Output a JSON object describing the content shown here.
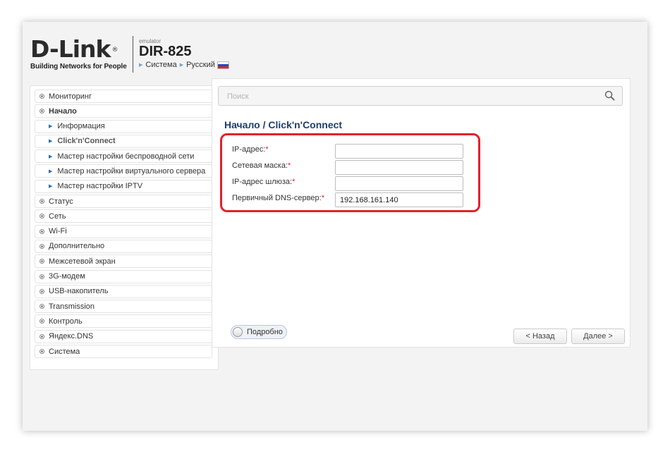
{
  "header": {
    "logo_text": "D-Link",
    "logo_reg": "®",
    "logo_tagline": "Building Networks for People",
    "emulator_label": "emulator",
    "model": "DIR-825",
    "nav_system": "Система",
    "nav_language": "Русский"
  },
  "sidebar": {
    "items": [
      {
        "label": "Мониторинг"
      },
      {
        "label": "Начало"
      },
      {
        "label": "Информация"
      },
      {
        "label": "Click'n'Connect"
      },
      {
        "label": "Мастер настройки беспроводной сети"
      },
      {
        "label": "Мастер настройки виртуального сервера"
      },
      {
        "label": "Мастер настройки IPTV"
      },
      {
        "label": "Статус"
      },
      {
        "label": "Сеть"
      },
      {
        "label": "Wi-Fi"
      },
      {
        "label": "Дополнительно"
      },
      {
        "label": "Межсетевой экран"
      },
      {
        "label": "3G-модем"
      },
      {
        "label": "USB-накопитель"
      },
      {
        "label": "Transmission"
      },
      {
        "label": "Контроль"
      },
      {
        "label": "Яндекс.DNS"
      },
      {
        "label": "Система"
      }
    ]
  },
  "search": {
    "placeholder": "Поиск",
    "value": ""
  },
  "page": {
    "title": "Начало /  Click'n'Connect"
  },
  "form": {
    "required_mark": "*",
    "fields": [
      {
        "label": "IP-адрес:",
        "value": ""
      },
      {
        "label": "Сетевая маска:",
        "value": ""
      },
      {
        "label": "IP-адрес шлюза:",
        "value": ""
      },
      {
        "label": "Первичный DNS-сервер:",
        "value": "192.168.161.140"
      }
    ]
  },
  "footer": {
    "toggle_label": "Подробно",
    "back_label": "< Назад",
    "next_label": "Далее >"
  },
  "colors": {
    "highlight_border": "#e4212a",
    "title": "#1d3e6b",
    "link_arrow": "#2d6fb0"
  }
}
